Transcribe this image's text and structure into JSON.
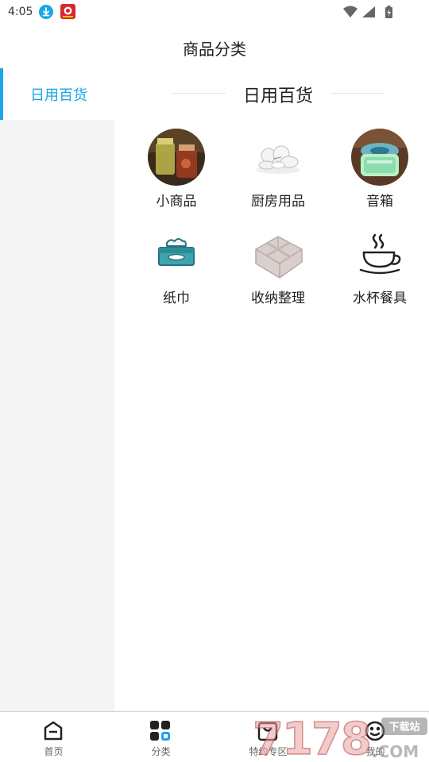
{
  "status_bar": {
    "time": "4:05"
  },
  "header": {
    "title": "商品分类"
  },
  "sidebar": {
    "items": [
      {
        "label": "日用百货",
        "selected": true
      }
    ]
  },
  "section": {
    "title": "日用百货"
  },
  "categories": [
    {
      "name": "小商品",
      "icon": "glass-jars-photo"
    },
    {
      "name": "厨房用品",
      "icon": "dish-set-photo"
    },
    {
      "name": "音箱",
      "icon": "speaker-photo"
    },
    {
      "name": "纸巾",
      "icon": "tissue-box-icon"
    },
    {
      "name": "收纳整理",
      "icon": "storage-organizer-icon"
    },
    {
      "name": "水杯餐具",
      "icon": "coffee-cup-icon"
    }
  ],
  "bottom_nav": [
    {
      "label": "首页",
      "icon": "home-icon",
      "active": false
    },
    {
      "label": "分类",
      "icon": "grid-icon",
      "active": true
    },
    {
      "label": "特约专区",
      "icon": "bag-icon",
      "active": false
    },
    {
      "label": "我的",
      "icon": "smiley-icon",
      "active": false
    }
  ],
  "watermark": {
    "text": "7178",
    "suffix": ".COM",
    "tag": "下载站"
  },
  "colors": {
    "accent": "#1aa5e8",
    "sidebar_bg": "#f4f4f4"
  }
}
